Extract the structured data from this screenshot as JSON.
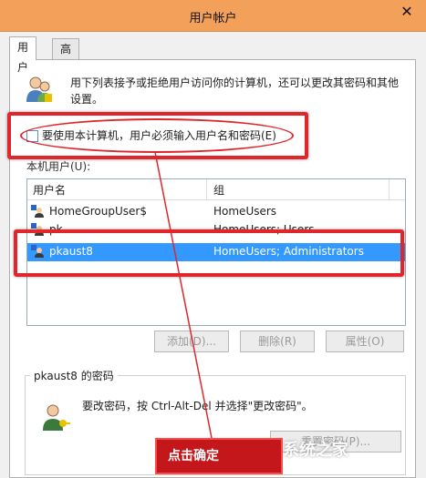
{
  "window": {
    "title": "用户帐户",
    "close_glyph": "✕"
  },
  "tabs": [
    {
      "label": "用户",
      "active": true
    },
    {
      "label": "高级",
      "active": false
    }
  ],
  "description": "用下列表接予或拒绝用户访问你的计算机，还可以更改其密码和其他设置。",
  "checkbox": {
    "label": "要使用本计算机，用户必须输入用户名和密码(E)",
    "checked": false
  },
  "local_users_label": "本机用户(U):",
  "table": {
    "columns": [
      "用户名",
      "组"
    ],
    "rows": [
      {
        "name": "HomeGroupUser$",
        "group": "HomeUsers",
        "selected": false
      },
      {
        "name": "pk",
        "group": "HomeUsers; Users",
        "selected": false
      },
      {
        "name": "pkaust8",
        "group": "HomeUsers; Administrators",
        "selected": true
      }
    ]
  },
  "buttons": {
    "add": "添加(D)...",
    "remove": "删除(R)",
    "properties": "属性(O)",
    "reset_password": "重置密码(P)..."
  },
  "password_section": {
    "title": "pkaust8 的密码",
    "text": "要改密码，按 Ctrl-Alt-Del 并选择\"更改密码\"。"
  },
  "annotation": {
    "label": "点击确定",
    "color": "#e0262a"
  },
  "watermark": "系统之家",
  "colors": {
    "titlebar": "#f3a05a",
    "selection": "#3399ff",
    "annotation_red": "#e0262a"
  },
  "icons": [
    "close-icon",
    "users-icon",
    "user-icon",
    "key-user-icon",
    "logo-icon"
  ]
}
